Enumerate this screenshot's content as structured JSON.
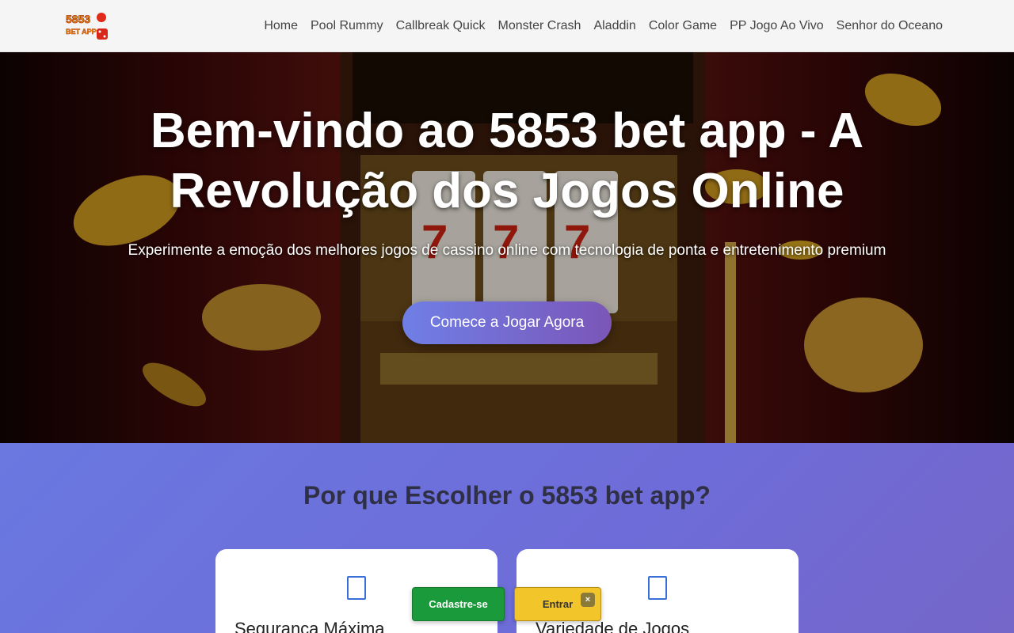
{
  "header": {
    "logo_text_top": "5853",
    "logo_text_bottom": "BET APP",
    "nav": [
      {
        "label": "Home"
      },
      {
        "label": "Pool Rummy"
      },
      {
        "label": "Callbreak Quick"
      },
      {
        "label": "Monster Crash"
      },
      {
        "label": "Aladdin"
      },
      {
        "label": "Color Game"
      },
      {
        "label": "PP Jogo Ao Vivo"
      },
      {
        "label": "Senhor do Oceano"
      }
    ]
  },
  "hero": {
    "title": "Bem-vindo ao 5853 bet app - A Revolução dos Jogos Online",
    "subtitle": "Experimente a emoção dos melhores jogos de cassino online com tecnologia de ponta e entretenimento premium",
    "cta": "Comece a Jogar Agora"
  },
  "features": {
    "title": "Por que Escolher o 5853 bet app?",
    "cards": [
      {
        "title": "Segurança Máxima",
        "icon": "shield-icon"
      },
      {
        "title": "Variedade de Jogos",
        "icon": "games-icon"
      }
    ]
  },
  "floating": {
    "register": "Cadastre-se",
    "login": "Entrar",
    "close": "×"
  },
  "colors": {
    "accent_gradient_start": "#6f7fe6",
    "accent_gradient_end": "#7b56b8",
    "register_green": "#1b9a3b",
    "login_yellow": "#f2c52a"
  }
}
